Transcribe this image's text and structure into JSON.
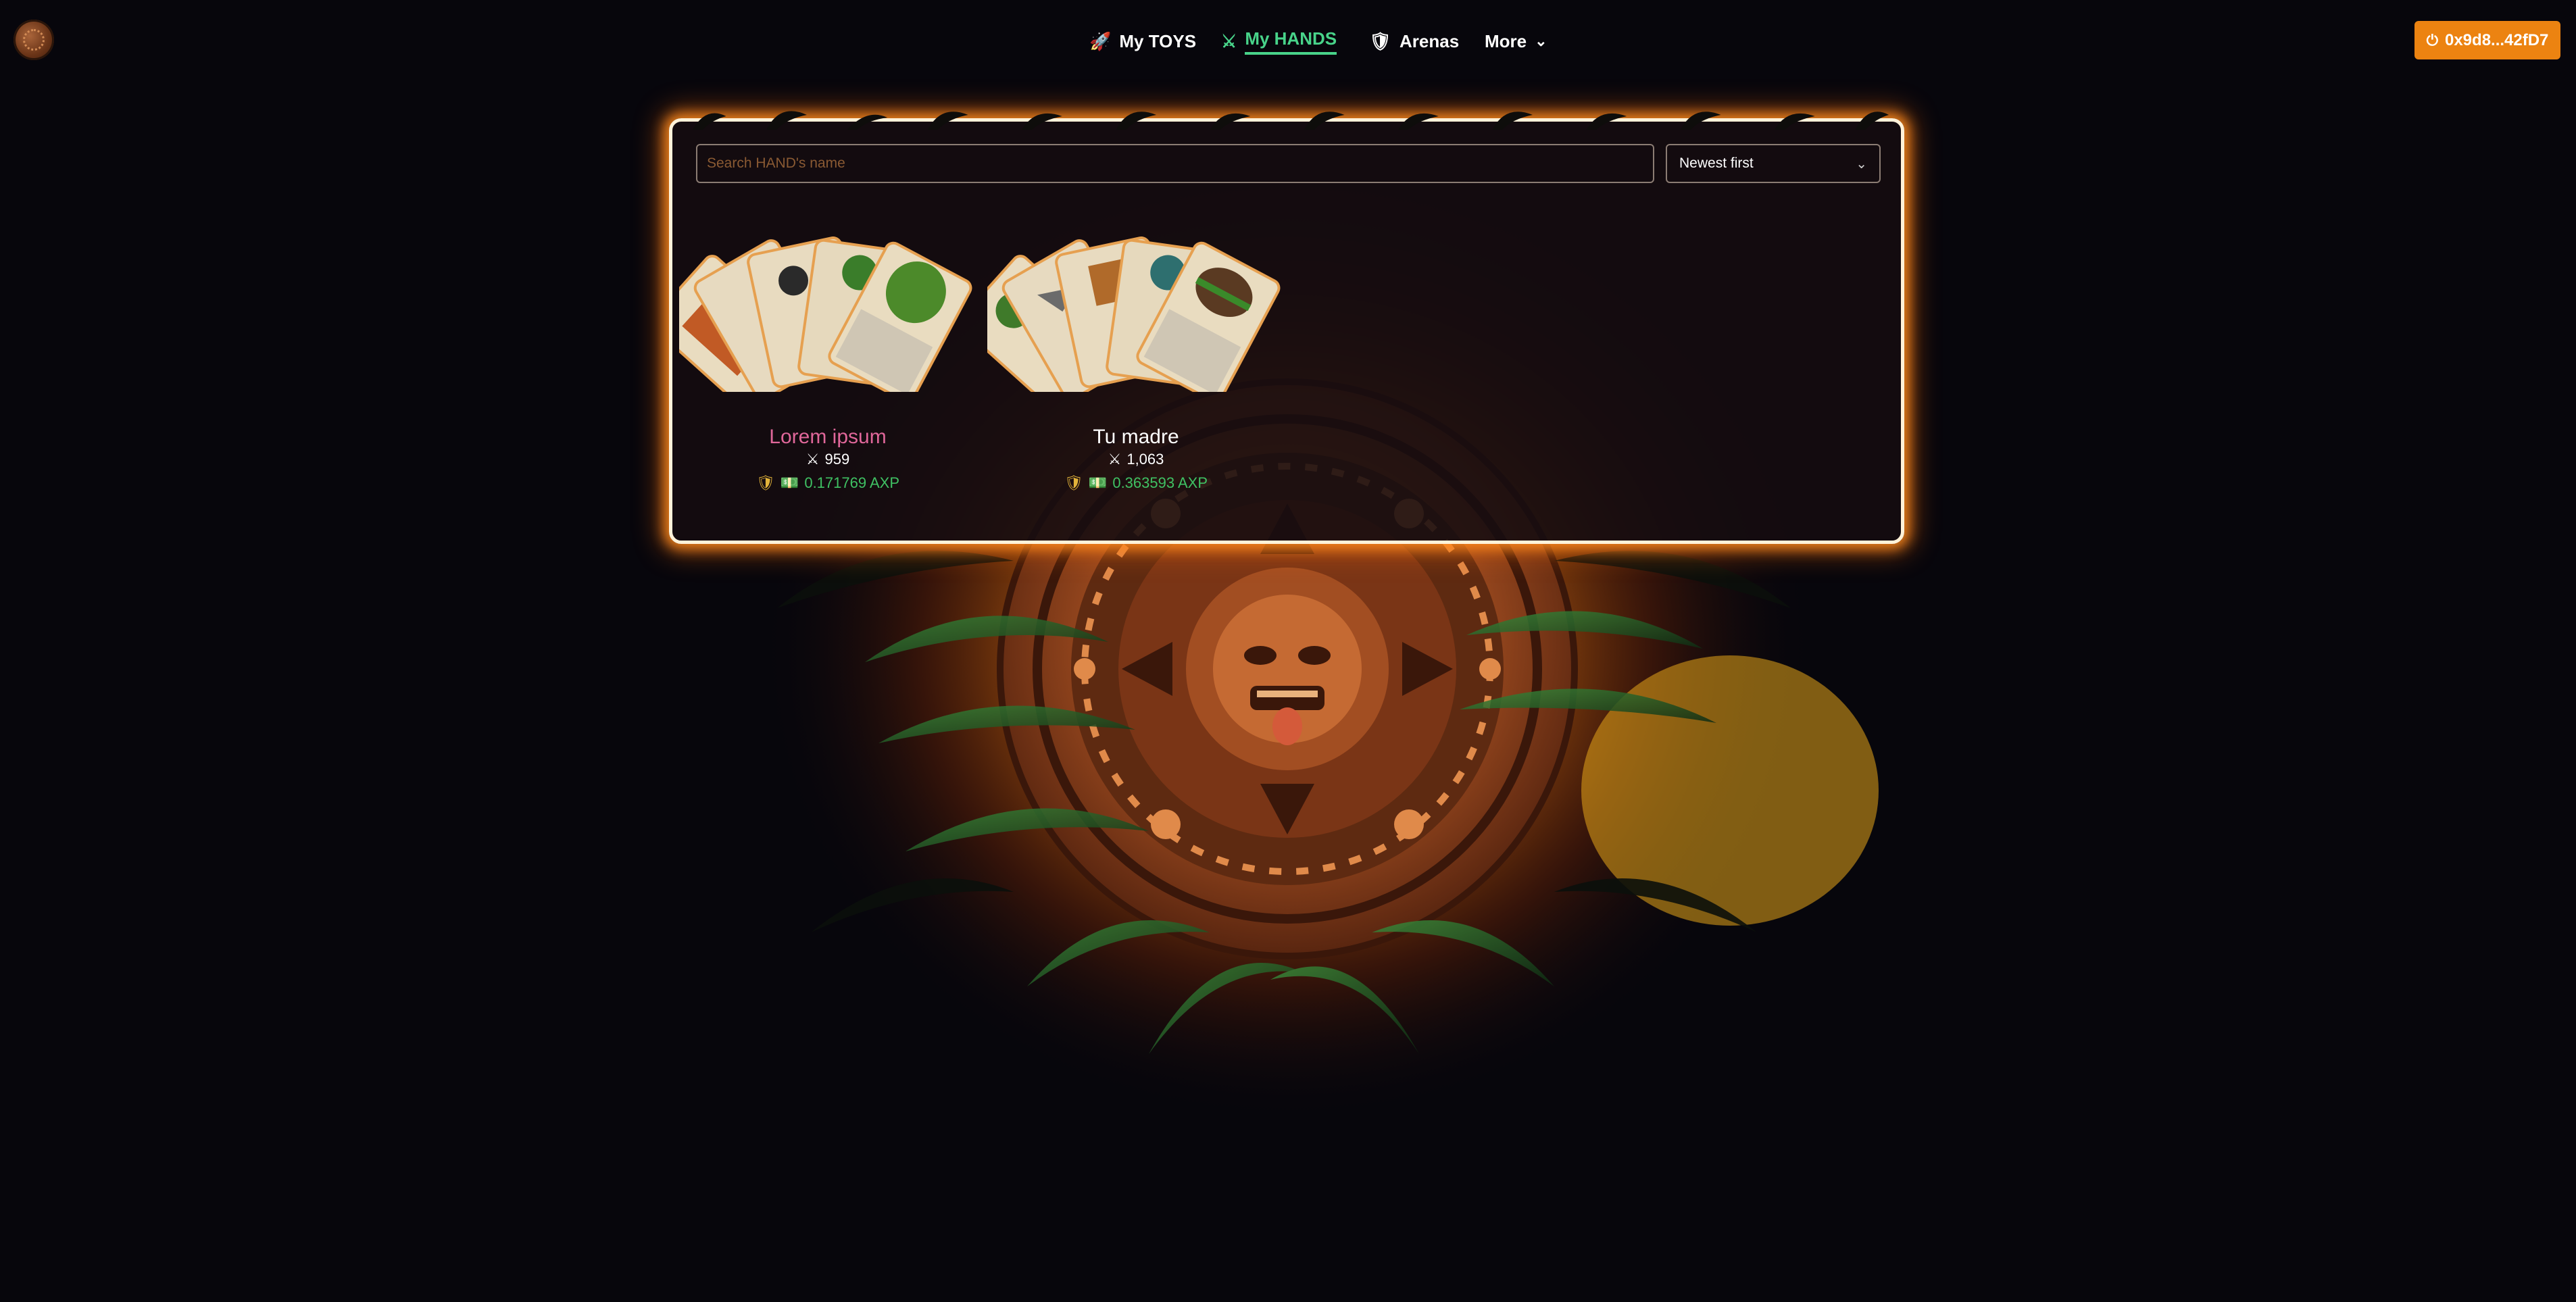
{
  "nav": {
    "items": [
      {
        "label": "My TOYS",
        "icon": "rocket-icon"
      },
      {
        "label": "My HANDS",
        "icon": "crossed-swords-icon",
        "active": true
      },
      {
        "label": "Arenas",
        "icon": "shield-icon"
      },
      {
        "label": "More",
        "icon": "chevron-down-icon"
      }
    ],
    "wallet": {
      "label": "0x9d8...42fD7",
      "icon": "power-icon"
    }
  },
  "colors": {
    "accent": "#48d38a",
    "wallet": "#ec8311",
    "panel_glow": "#ff8c1e",
    "pink_name": "#e0679a",
    "axp": "#3fc163"
  },
  "filters": {
    "search_placeholder": "Search HAND's name",
    "sort_selected": "Newest first"
  },
  "hands": [
    {
      "name": "Lorem ipsum",
      "battles": "959",
      "axp": "0.171769 AXP"
    },
    {
      "name": "Tu madre",
      "battles": "1,063",
      "axp": "0.363593 AXP"
    }
  ]
}
